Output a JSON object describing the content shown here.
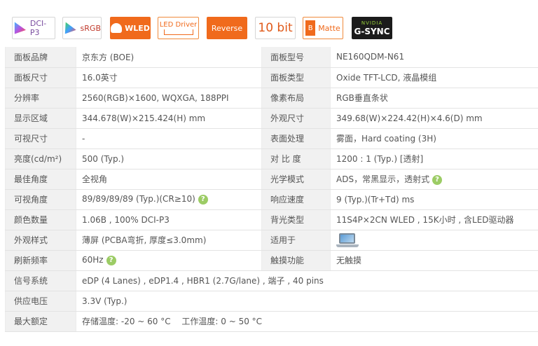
{
  "badges": [
    {
      "label": "DCI-P3"
    },
    {
      "label": "sRGB"
    },
    {
      "label": "WLED"
    },
    {
      "label": "LED Driver"
    },
    {
      "label": "Reverse"
    },
    {
      "label": "10 bit"
    },
    {
      "label": "Matte",
      "letter": "B"
    },
    {
      "label": "G-SYNC",
      "sub": "NVIDIA"
    }
  ],
  "specs": [
    {
      "k1": "面板品牌",
      "v1": "京东方 (BOE)",
      "k2": "面板型号",
      "v2": "NE160QDM-N61"
    },
    {
      "k1": "面板尺寸",
      "v1": "16.0英寸",
      "k2": "面板类型",
      "v2": "Oxide TFT-LCD, 液晶模组"
    },
    {
      "k1": "分辨率",
      "v1": "2560(RGB)×1600, WQXGA, 188PPI",
      "k2": "像素布局",
      "v2": "RGB垂直条状"
    },
    {
      "k1": "显示区域",
      "v1": "344.678(W)×215.424(H) mm",
      "k2": "外观尺寸",
      "v2": "349.68(W)×224.42(H)×4.6(D) mm"
    },
    {
      "k1": "可视尺寸",
      "v1": "-",
      "k2": "表面处理",
      "v2": "雾面，Hard coating (3H)"
    },
    {
      "k1": "亮度(cd/m²)",
      "v1": "500 (Typ.)",
      "k2": "对 比 度",
      "v2": "1200 : 1 (Typ.) [透射]"
    },
    {
      "k1": "最佳角度",
      "v1": "全视角",
      "k2": "光学模式",
      "v2": "ADS，常黑显示，透射式"
    },
    {
      "k1": "可视角度",
      "v1": "89/89/89/89 (Typ.)(CR≥10)",
      "k2": "响应速度",
      "v2": "9 (Typ.)(Tr+Td) ms"
    },
    {
      "k1": "颜色数量",
      "v1": "1.06B , 100% DCI-P3",
      "k2": "背光类型",
      "v2": "11S4P×2CN WLED , 15K小时 , 含LED驱动器"
    },
    {
      "k1": "外观样式",
      "v1": "薄屏 (PCBA弯折, 厚度≤3.0mm)",
      "k2": "适用于",
      "v2": ""
    },
    {
      "k1": "刷新频率",
      "v1": "60Hz",
      "k2": "触摸功能",
      "v2": "无触摸"
    },
    {
      "k1": "信号系统",
      "v1": "eDP (4 Lanes) , eDP1.4 , HBR1 (2.7G/lane) , 端子 , 40 pins"
    },
    {
      "k1": "供应电压",
      "v1": "3.3V (Typ.)"
    },
    {
      "k1": "最大额定",
      "v1": "存储温度: -20 ~ 60 °C　 工作温度: 0 ~ 50 °C"
    }
  ],
  "help_icon_text": "?",
  "colors": {
    "accent": "#f06a1c",
    "label_bg": "#f1f1f1",
    "help_green": "#9ccc65"
  }
}
